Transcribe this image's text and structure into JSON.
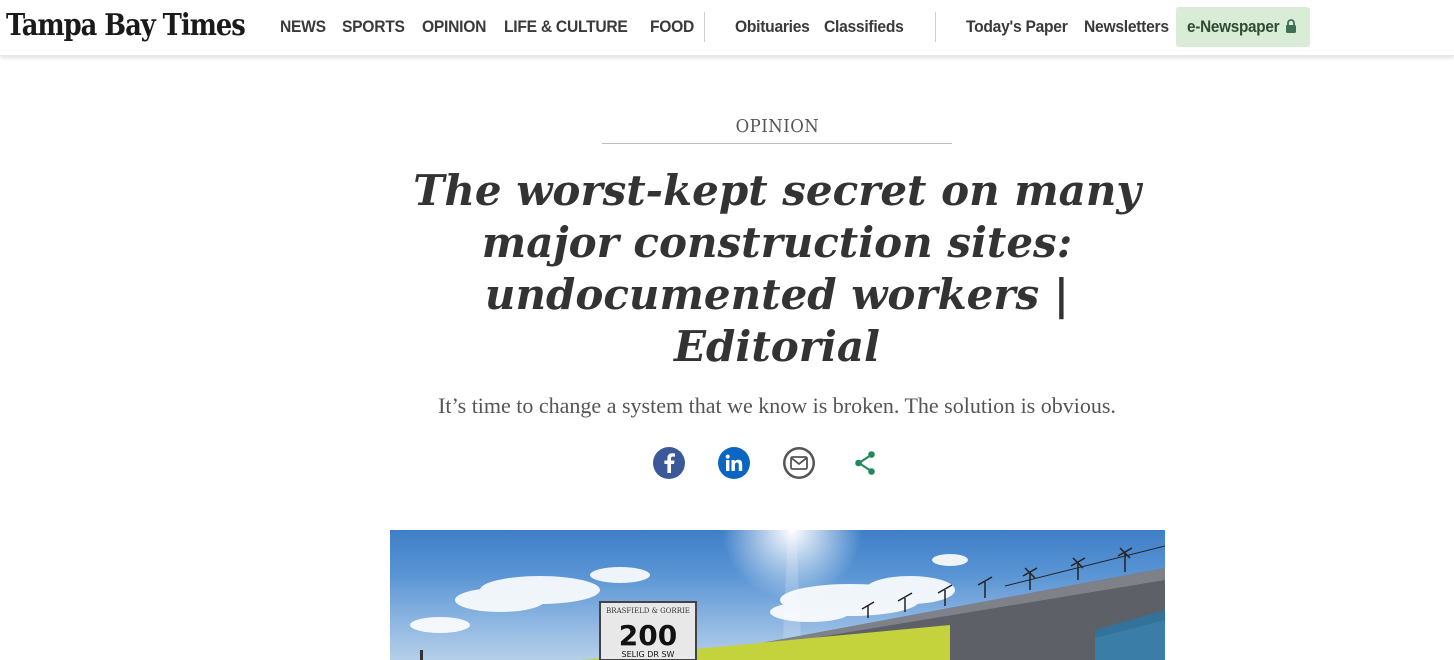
{
  "header": {
    "logo": "Tampa Bay Times",
    "main_nav": [
      "NEWS",
      "SPORTS",
      "OPINION",
      "LIFE & CULTURE",
      "FOOD"
    ],
    "secondary_nav": [
      "Obituaries",
      "Classifieds"
    ],
    "right_nav": [
      "Today's Paper",
      "Newsletters"
    ],
    "enewspaper": "e-Newspaper"
  },
  "article": {
    "section": "OPINION",
    "headline": "The worst-kept secret on many major construction sites: undocumented workers | Editorial",
    "subhead": "It’s time to change a system that we know is broken. The solution is obvious."
  },
  "share": [
    {
      "icon": "facebook-icon",
      "color": "#3b5998"
    },
    {
      "icon": "linkedin-icon",
      "color": "#0a66c2"
    },
    {
      "icon": "email-icon",
      "color": "#555555"
    },
    {
      "icon": "share-icon",
      "color": "#1f8a5b"
    }
  ],
  "hero": {
    "sign_company": "BRASFIELD & GORRIE",
    "sign_number": "200",
    "sign_street": "SELIG DR SW"
  }
}
